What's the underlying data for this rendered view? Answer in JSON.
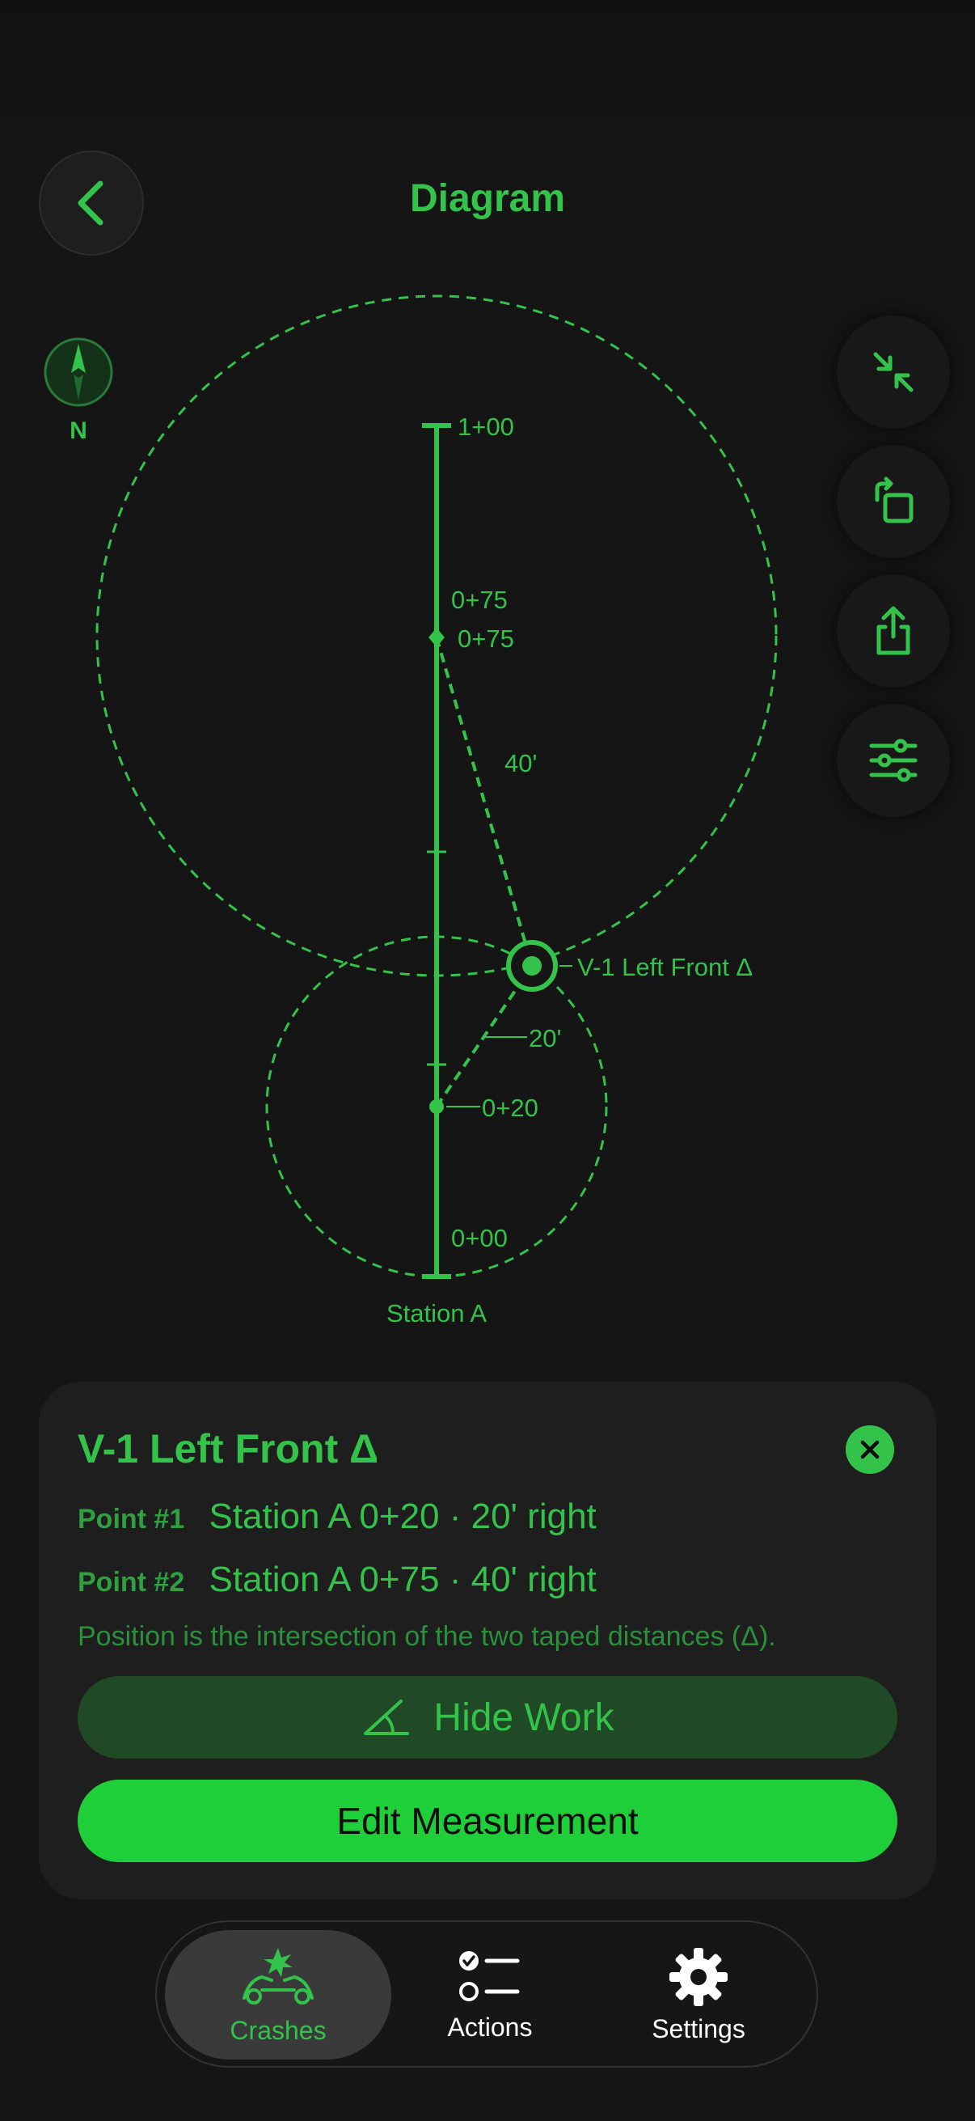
{
  "header": {
    "title": "Diagram"
  },
  "compass": {
    "label": "N"
  },
  "diagram": {
    "baseline_labels": {
      "top": "1+00",
      "p75_left": "0+75",
      "p75_right": "0+75",
      "p20": "0+20",
      "bottom": "0+00"
    },
    "distance_labels": {
      "long": "40'",
      "short": "20'"
    },
    "point_label": "V-1 Left Front Δ",
    "station_label": "Station A"
  },
  "panel": {
    "title": "V-1 Left Front Δ",
    "point1_label": "Point #1",
    "point1_value": "Station A 0+20 · 20' right",
    "point2_label": "Point #2",
    "point2_value": "Station A 0+75 · 40' right",
    "note": "Position is the intersection of the two taped distances (Δ).",
    "hide_button": "Hide Work",
    "edit_button": "Edit Measurement"
  },
  "tabbar": {
    "tabs": [
      {
        "label": "Crashes"
      },
      {
        "label": "Actions"
      },
      {
        "label": "Settings"
      }
    ]
  },
  "colors": {
    "accent": "#33c24a",
    "bright": "#1fcf3a",
    "background": "#151515"
  }
}
